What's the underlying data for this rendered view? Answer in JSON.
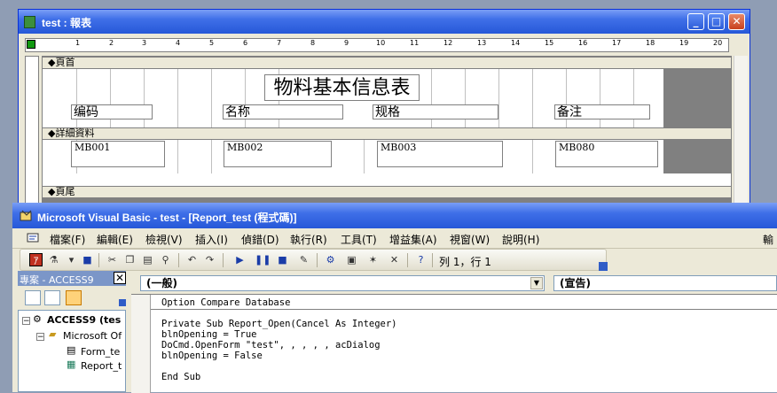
{
  "report_window": {
    "title": "test : 報表",
    "controls": {
      "minimize": "_",
      "maximize": "□",
      "close": "✕"
    },
    "ruler_ticks": [
      "1",
      "2",
      "3",
      "4",
      "5",
      "6",
      "7",
      "8",
      "9",
      "10",
      "11",
      "12",
      "13",
      "14",
      "15",
      "16",
      "17",
      "18",
      "19",
      "20"
    ],
    "sections": {
      "header": "◆頁首",
      "detail": "◆詳細資料",
      "footer": "◆頁尾"
    },
    "report_title": "物料基本信息表",
    "labels": [
      "编码",
      "名称",
      "规格",
      "备注"
    ],
    "fields": [
      "MB001",
      "MB002",
      "MB003",
      "MB080"
    ]
  },
  "vb_window": {
    "title": "Microsoft Visual Basic - test - [Report_test (程式碼)]",
    "menu": [
      "檔案(F)",
      "編輯(E)",
      "檢視(V)",
      "插入(I)",
      "偵錯(D)",
      "執行(R)",
      "工具(T)",
      "增益集(A)",
      "視窗(W)",
      "說明(H)"
    ],
    "menu_truncated": "輸",
    "toolbar": {
      "position": "列 1，行 1"
    },
    "project": {
      "header": "專案 - ACCESS9",
      "close": "✕",
      "tree": [
        {
          "label": "ACCESS9 (tes",
          "level": 0
        },
        {
          "label": "Microsoft Of",
          "level": 1
        },
        {
          "label": "Form_te",
          "level": 2
        },
        {
          "label": "Report_t",
          "level": 2
        }
      ]
    },
    "object_combo": "(一般)",
    "proc_combo": "(宣告)",
    "code_lines": [
      "Option Compare Database",
      "Private Sub Report_Open(Cancel As Integer)",
      "blnOpening = True",
      "DoCmd.OpenForm \"test\", , , , , acDialog",
      "blnOpening = False",
      "End Sub"
    ]
  }
}
